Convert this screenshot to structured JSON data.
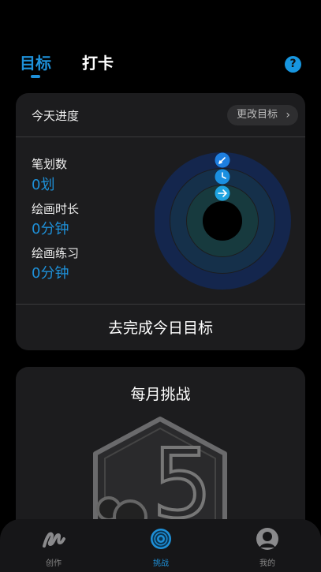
{
  "header": {
    "tabs": [
      {
        "label": "目标",
        "active": true
      },
      {
        "label": "打卡",
        "active": false
      }
    ],
    "help_icon": "question-circle-icon",
    "help_text": "?"
  },
  "progress_card": {
    "title": "今天进度",
    "change_button": "更改目标",
    "stats": [
      {
        "label": "笔划数",
        "value": "0划"
      },
      {
        "label": "绘画时长",
        "value": "0分钟"
      },
      {
        "label": "绘画练习",
        "value": "0分钟"
      }
    ],
    "rings": {
      "stroke_progress": 0,
      "duration_progress": 0,
      "practice_progress": 0,
      "icons": [
        "pen-icon",
        "clock-icon",
        "arrow-right-icon"
      ]
    },
    "complete_button": "去完成今日目标"
  },
  "challenge_card": {
    "title": "每月挑战",
    "badge_number": "5"
  },
  "bottom_nav": {
    "items": [
      {
        "label": "创作",
        "icon": "create-icon",
        "active": false
      },
      {
        "label": "挑战",
        "icon": "challenge-icon",
        "active": true
      },
      {
        "label": "我的",
        "icon": "profile-icon",
        "active": false
      }
    ]
  },
  "colors": {
    "accent": "#1e90d8",
    "card_bg": "#1c1c1e",
    "background": "#000000"
  }
}
